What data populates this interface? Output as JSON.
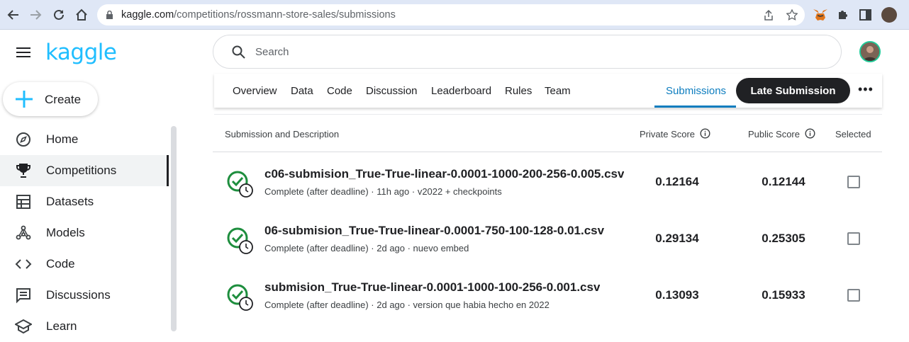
{
  "browser": {
    "url_host": "kaggle.com",
    "url_path": "/competitions/rossmann-store-sales/submissions"
  },
  "sidebar": {
    "logo": "kaggle",
    "create_label": "Create",
    "items": [
      {
        "label": "Home",
        "icon": "compass-icon"
      },
      {
        "label": "Competitions",
        "icon": "trophy-icon",
        "active": true
      },
      {
        "label": "Datasets",
        "icon": "table-icon"
      },
      {
        "label": "Models",
        "icon": "models-icon"
      },
      {
        "label": "Code",
        "icon": "code-icon"
      },
      {
        "label": "Discussions",
        "icon": "comments-icon"
      },
      {
        "label": "Learn",
        "icon": "school-icon"
      }
    ]
  },
  "search": {
    "placeholder": "Search"
  },
  "tabs": {
    "items": [
      "Overview",
      "Data",
      "Code",
      "Discussion",
      "Leaderboard",
      "Rules",
      "Team"
    ],
    "active": "Submissions",
    "late_submission": "Late Submission",
    "more": "•••"
  },
  "table": {
    "headers": {
      "description": "Submission and Description",
      "private": "Private Score",
      "public": "Public Score",
      "selected": "Selected"
    },
    "rows": [
      {
        "name": "c06-submision_True-True-linear-0.0001-1000-200-256-0.005.csv",
        "meta": "Complete (after deadline) · 11h ago · v2022 + checkpoints",
        "private": "0.12164",
        "public": "0.12144",
        "selected": false
      },
      {
        "name": "06-submision_True-True-linear-0.0001-750-100-128-0.01.csv",
        "meta": "Complete (after deadline) · 2d ago · nuevo embed",
        "private": "0.29134",
        "public": "0.25305",
        "selected": false
      },
      {
        "name": "submision_True-True-linear-0.0001-1000-100-256-0.001.csv",
        "meta": "Complete (after deadline) · 2d ago · version que habia hecho en 2022",
        "private": "0.13093",
        "public": "0.15933",
        "selected": false
      }
    ]
  },
  "colors": {
    "brand": "#20beff",
    "status_green": "#1e8e3e",
    "tab_active": "#0d7dbf"
  }
}
